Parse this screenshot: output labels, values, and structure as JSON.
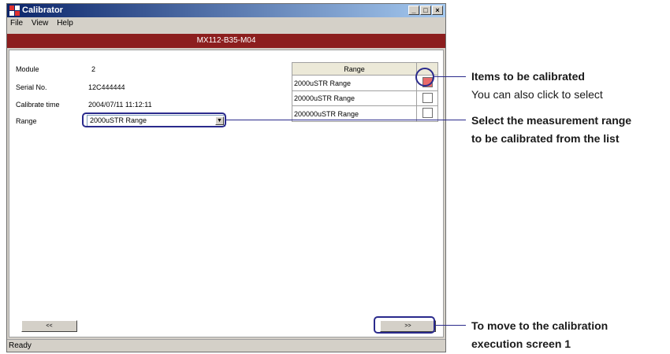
{
  "window": {
    "title": "Calibrator",
    "controls": [
      "_",
      "□",
      "×"
    ]
  },
  "menu": [
    "File",
    "View",
    "Help"
  ],
  "header": {
    "text": "MX112-B35-M04"
  },
  "fields": {
    "module_label": "Module",
    "module_value": "2",
    "serial_label": "Serial No.",
    "serial_value": "12C444444",
    "calibrate_time_label": "Calibrate time",
    "calibrate_time_value": "2004/07/11 11:12:11",
    "range_label": "Range",
    "range_selected": "2000uSTR Range"
  },
  "range_table": {
    "header": "Range",
    "rows": [
      {
        "label": "2000uSTR Range",
        "checked": true
      },
      {
        "label": "20000uSTR Range",
        "checked": false
      },
      {
        "label": "200000uSTR Range",
        "checked": false
      }
    ]
  },
  "buttons": {
    "prev": "<<",
    "next": ">>"
  },
  "status": "Ready",
  "annotations": {
    "items_title": "Items to be calibrated",
    "items_sub": "You can also click to select",
    "range_line1": "Select the measurement range",
    "range_line2": "to be calibrated from the list",
    "next_line1": "To move to the calibration",
    "next_line2": "execution screen 1"
  },
  "colors": {
    "header_bar": "#8c1e1e",
    "highlight": "#2a2a8c",
    "checked": "#e86a6a"
  }
}
